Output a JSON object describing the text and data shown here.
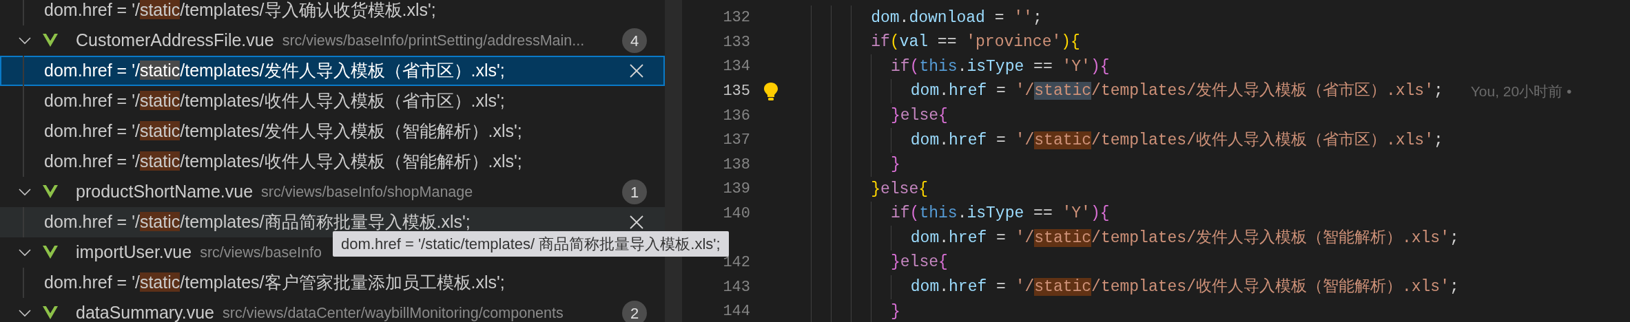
{
  "search_results": [
    {
      "kind": "match",
      "before": "dom.href = '/",
      "match": "static",
      "after": "/templates/导入确认收货模板.xls';",
      "selected": false,
      "hovered": false
    },
    {
      "kind": "file",
      "name": "CustomerAddressFile.vue",
      "path": "src/views/baseInfo/printSetting/addressMain...",
      "badge": "4",
      "expanded": true
    },
    {
      "kind": "match",
      "before": "dom.href = '/",
      "match": "static",
      "after": "/templates/发件人导入模板（省市区）.xls';",
      "selected": true,
      "hovered": false
    },
    {
      "kind": "match",
      "before": "dom.href = '/",
      "match": "static",
      "after": "/templates/收件人导入模板（省市区）.xls';",
      "selected": false,
      "hovered": false
    },
    {
      "kind": "match",
      "before": "dom.href = '/",
      "match": "static",
      "after": "/templates/发件人导入模板（智能解析）.xls';",
      "selected": false,
      "hovered": false
    },
    {
      "kind": "match",
      "before": "dom.href = '/",
      "match": "static",
      "after": "/templates/收件人导入模板（智能解析）.xls';",
      "selected": false,
      "hovered": false
    },
    {
      "kind": "file",
      "name": "productShortName.vue",
      "path": "src/views/baseInfo/shopManage",
      "badge": "1",
      "expanded": true
    },
    {
      "kind": "match",
      "before": "dom.href = '/",
      "match": "static",
      "after": "/templates/商品简称批量导入模板.xls';",
      "selected": false,
      "hovered": true
    },
    {
      "kind": "file",
      "name": "importUser.vue",
      "path": "src/views/baseInfo",
      "expanded": true
    },
    {
      "kind": "match",
      "before": "dom.href = '/",
      "match": "static",
      "after": "/templates/客户管家批量添加员工模板.xls';",
      "selected": false,
      "hovered": false
    },
    {
      "kind": "file",
      "name": "dataSummary.vue",
      "path": "src/views/dataCenter/waybillMonitoring/components",
      "badge": "2",
      "expanded": true
    }
  ],
  "tooltip": "dom.href = '/static/templates/ 商品简称批量导入模板.xls';",
  "editor": {
    "lines": [
      {
        "number": "132",
        "current": false,
        "tokens": [
          {
            "text": "dom",
            "kind": "var"
          },
          {
            "text": ".",
            "kind": "op"
          },
          {
            "text": "download",
            "kind": "var"
          },
          {
            "text": " = ",
            "kind": "op"
          },
          {
            "text": "''",
            "kind": "str"
          },
          {
            "text": ";",
            "kind": "op"
          }
        ]
      },
      {
        "number": "133",
        "current": false,
        "tokens": [
          {
            "text": "if",
            "kind": "kw"
          },
          {
            "text": "(",
            "kind": "b1"
          },
          {
            "text": "val",
            "kind": "var"
          },
          {
            "text": " == ",
            "kind": "op"
          },
          {
            "text": "'province'",
            "kind": "str"
          },
          {
            "text": "){",
            "kind": "b1"
          }
        ],
        "children": [
          {
            "number": "134",
            "current": false,
            "tokens": [
              {
                "text": "if",
                "kind": "kw"
              },
              {
                "text": "(",
                "kind": "b2"
              },
              {
                "text": "this",
                "kind": "this"
              },
              {
                "text": ".",
                "kind": "op"
              },
              {
                "text": "isType",
                "kind": "var"
              },
              {
                "text": " == ",
                "kind": "op"
              },
              {
                "text": "'Y'",
                "kind": "str"
              },
              {
                "text": "){",
                "kind": "b2"
              }
            ],
            "children": [
              {
                "number": "135",
                "current": true,
                "lightbulb": true,
                "blame": "You, 20小时前 •",
                "tokens": [
                  {
                    "text": "dom",
                    "kind": "var"
                  },
                  {
                    "text": ".",
                    "kind": "op"
                  },
                  {
                    "text": "href",
                    "kind": "var"
                  },
                  {
                    "text": " = ",
                    "kind": "op"
                  },
                  {
                    "text": "'/",
                    "kind": "str"
                  },
                  {
                    "text": "static",
                    "kind": "selmatch"
                  },
                  {
                    "text": "/templates/发件人导入模板（省市区）.xls'",
                    "kind": "str"
                  },
                  {
                    "text": ";",
                    "kind": "op"
                  }
                ]
              }
            ]
          },
          {
            "number": "136",
            "current": false,
            "tokens": [
              {
                "text": "}",
                "kind": "b2"
              },
              {
                "text": "else",
                "kind": "kw"
              },
              {
                "text": "{",
                "kind": "b2"
              }
            ],
            "children": [
              {
                "number": "137",
                "current": false,
                "tokens": [
                  {
                    "text": "dom",
                    "kind": "var"
                  },
                  {
                    "text": ".",
                    "kind": "op"
                  },
                  {
                    "text": "href",
                    "kind": "var"
                  },
                  {
                    "text": " = ",
                    "kind": "op"
                  },
                  {
                    "text": "'/",
                    "kind": "str"
                  },
                  {
                    "text": "static",
                    "kind": "match"
                  },
                  {
                    "text": "/templates/收件人导入模板（省市区）.xls'",
                    "kind": "str"
                  },
                  {
                    "text": ";",
                    "kind": "op"
                  }
                ]
              }
            ]
          },
          {
            "number": "138",
            "current": false,
            "tokens": [
              {
                "text": "}",
                "kind": "b2"
              }
            ]
          }
        ]
      },
      {
        "number": "139",
        "current": false,
        "tokens": [
          {
            "text": "}",
            "kind": "b1"
          },
          {
            "text": "else",
            "kind": "kw"
          },
          {
            "text": "{",
            "kind": "b1"
          }
        ],
        "children": [
          {
            "number": "140",
            "current": false,
            "tokens": [
              {
                "text": "if",
                "kind": "kw"
              },
              {
                "text": "(",
                "kind": "b2"
              },
              {
                "text": "this",
                "kind": "this"
              },
              {
                "text": ".",
                "kind": "op"
              },
              {
                "text": "isType",
                "kind": "var"
              },
              {
                "text": " == ",
                "kind": "op"
              },
              {
                "text": "'Y'",
                "kind": "str"
              },
              {
                "text": "){",
                "kind": "b2"
              }
            ],
            "children": [
              {
                "tokens": [
                  {
                    "text": "dom",
                    "kind": "var"
                  },
                  {
                    "text": ".",
                    "kind": "op"
                  },
                  {
                    "text": "href",
                    "kind": "var"
                  },
                  {
                    "text": " = ",
                    "kind": "op"
                  },
                  {
                    "text": "'/",
                    "kind": "str"
                  },
                  {
                    "text": "static",
                    "kind": "match"
                  },
                  {
                    "text": "/templates/发件人导入模板（智能解析）.xls'",
                    "kind": "str"
                  },
                  {
                    "text": ";",
                    "kind": "op"
                  }
                ]
              }
            ]
          },
          {
            "number": "142",
            "current": false,
            "tokens": [
              {
                "text": "}",
                "kind": "b2"
              },
              {
                "text": "else",
                "kind": "kw"
              },
              {
                "text": "{",
                "kind": "b2"
              }
            ],
            "children": [
              {
                "number": "143",
                "current": false,
                "tokens": [
                  {
                    "text": "dom",
                    "kind": "var"
                  },
                  {
                    "text": ".",
                    "kind": "op"
                  },
                  {
                    "text": "href",
                    "kind": "var"
                  },
                  {
                    "text": " = ",
                    "kind": "op"
                  },
                  {
                    "text": "'/",
                    "kind": "str"
                  },
                  {
                    "text": "static",
                    "kind": "match"
                  },
                  {
                    "text": "/templates/收件人导入模板（智能解析）.xls'",
                    "kind": "str"
                  },
                  {
                    "text": ";",
                    "kind": "op"
                  }
                ]
              }
            ]
          },
          {
            "number": "144",
            "current": false,
            "tokens": [
              {
                "text": "}",
                "kind": "b2"
              }
            ]
          }
        ]
      }
    ]
  }
}
